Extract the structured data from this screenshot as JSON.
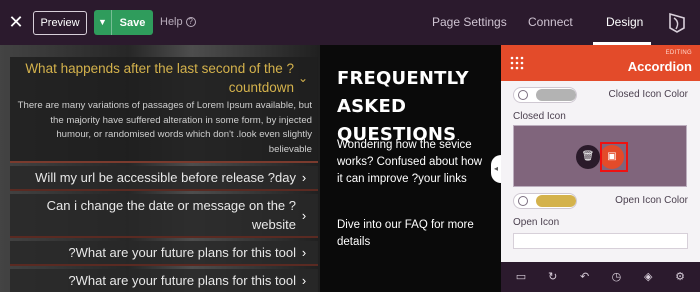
{
  "topbar": {
    "close_label": "✕",
    "preview_label": "Preview",
    "save_caret": "▼",
    "save_label": "Save",
    "help_label": "Help",
    "help_icon": "?",
    "tabs": [
      {
        "label": "Page Settings"
      },
      {
        "label": "Connect"
      },
      {
        "label": "Design"
      }
    ],
    "active_tab": "Design"
  },
  "canvas": {
    "faq": {
      "open_item": {
        "question": "What happends after the last second of the ?countdown",
        "caret": "⌄",
        "answer": "There are many variations of passages of Lorem Ipsum available, but the majority have suffered alteration in some form, by injected humour, or randomised words which don't .look even slightly believable"
      },
      "items": [
        {
          "question": "Will my url be accessible before release ?day",
          "chevron": "›"
        },
        {
          "question": "Can i change the date or message on the ?website",
          "chevron": "›"
        },
        {
          "question": "?What are your future plans for this tool",
          "chevron": "›"
        },
        {
          "question": "?What are your future plans for this tool",
          "chevron": "›"
        }
      ]
    },
    "heading": "FREQUENTLY ASKED QUESTIONS",
    "intro": "Wondering how the sevice works? Confused about how it can improve ?your links",
    "cta": "Dive into our FAQ for more details",
    "collapse_handle": "◂"
  },
  "panel": {
    "editing_label": "EDITING",
    "title": "Accordion",
    "closed_icon_color_label": "Closed Icon Color",
    "closed_icon_color": "#b3b3b3",
    "closed_icon_label": "Closed Icon",
    "open_icon_color_label": "Open Icon Color",
    "open_icon_color": "#d4b24c",
    "open_icon_label": "Open Icon",
    "accent": "#e34b2a",
    "footer_icons": [
      "tablet-icon",
      "refresh-icon",
      "undo-icon",
      "history-icon",
      "layers-icon",
      "settings-icon"
    ]
  }
}
